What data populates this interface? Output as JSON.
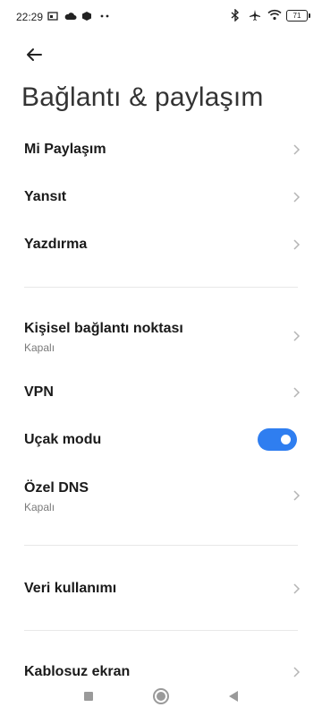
{
  "status": {
    "time": "22:29",
    "battery": "71",
    "icons": [
      "image-icon",
      "cloud-icon",
      "box-icon",
      "dots-icon",
      "bluetooth-icon",
      "airplane-icon",
      "wifi-icon",
      "battery-icon"
    ]
  },
  "header": {
    "back_icon": "back-arrow-icon",
    "title": "Bağlantı & paylaşım"
  },
  "sections": {
    "mi_share": "Mi Paylaşım",
    "cast": "Yansıt",
    "print": "Yazdırma",
    "hotspot": {
      "label": "Kişisel bağlantı noktası",
      "sub": "Kapalı"
    },
    "vpn": "VPN",
    "airplane": {
      "label": "Uçak modu",
      "on": true
    },
    "private_dns": {
      "label": "Özel DNS",
      "sub": "Kapalı"
    },
    "data_usage": "Veri kullanımı",
    "wireless_display": "Kablosuz ekran"
  },
  "colors": {
    "accent": "#2f7ef0",
    "chevron": "#b5b5b5"
  },
  "nav": [
    "recents-square-icon",
    "home-circle-icon",
    "back-triangle-icon"
  ]
}
